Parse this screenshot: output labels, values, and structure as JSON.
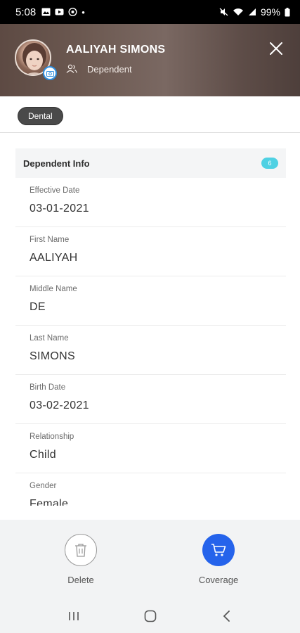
{
  "status_bar": {
    "time": "5:08",
    "battery": "99%"
  },
  "header": {
    "name": "AALIYAH SIMONS",
    "role": "Dependent",
    "background_color": "#6b5850"
  },
  "tags": {
    "selected": "Dental"
  },
  "dependent_info": {
    "title": "Dependent Info",
    "badge": "6",
    "badge_color": "#4fd1e3",
    "fields": [
      {
        "label": "Effective Date",
        "value": "03-01-2021"
      },
      {
        "label": "First Name",
        "value": "AALIYAH"
      },
      {
        "label": "Middle Name",
        "value": "DE"
      },
      {
        "label": "Last Name",
        "value": "SIMONS"
      },
      {
        "label": "Birth Date",
        "value": "03-02-2021"
      },
      {
        "label": "Relationship",
        "value": "Child"
      },
      {
        "label": "Gender",
        "value": "Female"
      }
    ]
  },
  "actions": {
    "delete_label": "Delete",
    "coverage_label": "Coverage",
    "coverage_color": "#2563eb"
  },
  "icons": {
    "close": "close-icon",
    "trash": "trash-icon",
    "cart": "cart-icon",
    "people": "people-icon",
    "camera": "camera-icon"
  }
}
